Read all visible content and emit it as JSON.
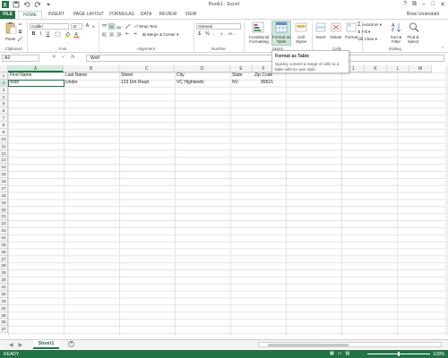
{
  "app": {
    "title": "Book1 - Excel"
  },
  "tabs": [
    "FILE",
    "HOME",
    "INSERT",
    "PAGE LAYOUT",
    "FORMULAS",
    "DATA",
    "REVIEW",
    "VIEW"
  ],
  "user": "Brian Underdahl",
  "ribbon": {
    "clipboard": {
      "paste": "Paste",
      "label": "Clipboard"
    },
    "font": {
      "name": "Calibri",
      "size": "11",
      "label": "Font",
      "bold": "B",
      "italic": "I",
      "underline": "U"
    },
    "alignment": {
      "wrap": "Wrap Text",
      "merge": "Merge & Center",
      "label": "Alignment"
    },
    "number": {
      "format": "General",
      "currency": "$",
      "percent": "%",
      "comma": ",",
      "label": "Number"
    },
    "styles": {
      "conditional_1": "Conditional",
      "conditional_2": "Formatting",
      "format_table_1": "Format as",
      "format_table_2": "Table",
      "cell_styles_1": "Cell",
      "cell_styles_2": "Styles",
      "label": "Styles"
    },
    "cells": {
      "insert": "Insert",
      "delete": "Delete",
      "format": "Format",
      "label": "Cells"
    },
    "editing": {
      "autosum": "AutoSum",
      "fill": "Fill",
      "clear": "Clear",
      "sort_1": "Sort &",
      "sort_2": "Filter",
      "find_1": "Find &",
      "find_2": "Select",
      "label": "Editing"
    }
  },
  "tooltip": {
    "title": "Format as Table",
    "body": "Quickly convert a range of cells to a table with its own style."
  },
  "formula_bar": {
    "name_box": "A2",
    "content": "Wolf"
  },
  "columns": [
    "A",
    "B",
    "C",
    "D",
    "E",
    "F",
    "G",
    "H",
    "I",
    "J",
    "K",
    "L",
    "M"
  ],
  "rows": [
    "1",
    "2",
    "3",
    "4",
    "5",
    "6",
    "7",
    "8",
    "9",
    "10",
    "11",
    "12",
    "13",
    "14",
    "15",
    "16",
    "17",
    "18",
    "19",
    "20",
    "21",
    "22",
    "23",
    "24",
    "25",
    "26",
    "27",
    "28",
    "29",
    "30",
    "31",
    "32",
    "33",
    "34",
    "35",
    "36",
    "37"
  ],
  "cells": {
    "a1": "First Name",
    "b1": "Last Name",
    "c1": "Street",
    "d1": "City",
    "e1": "State",
    "f1": "Zip Code",
    "a2": "Wolf",
    "b2": "Under",
    "c2": "123 Dirt Road",
    "d2": "VC Highlands",
    "e2": "NV",
    "f2": "89521"
  },
  "sheets": {
    "active": "Sheet1"
  },
  "status": {
    "ready": "READY",
    "zoom": "100%"
  },
  "colors": {
    "accent": "#217346"
  }
}
